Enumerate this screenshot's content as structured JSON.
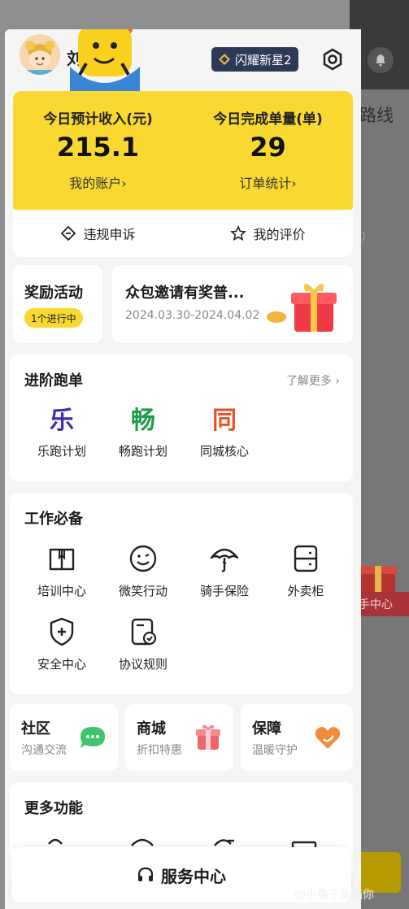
{
  "header": {
    "user_name": "刘",
    "badge_label": "闪耀新星2"
  },
  "income": {
    "today_income_label": "今日预计收入(元)",
    "today_income_value": "215.1",
    "account_link": "我的账户›",
    "today_orders_label": "今日完成单量(单)",
    "today_orders_value": "29",
    "order_stats_link": "订单统计›"
  },
  "actions": {
    "appeal_label": "违规申诉",
    "rating_label": "我的评价"
  },
  "reward": {
    "title": "奖励活动",
    "pill": "1个进行中"
  },
  "crowd": {
    "title": "众包邀请有奖普...",
    "date": "2024.03.30-2024.04.02"
  },
  "advanced": {
    "title": "进阶跑单",
    "learn_more": "了解更多 ›",
    "plans": [
      {
        "glyph": "乐",
        "label": "乐跑计划",
        "color": "#3d2fb0"
      },
      {
        "glyph": "畅",
        "label": "畅跑计划",
        "color": "#1f9b4a"
      },
      {
        "glyph": "同",
        "label": "同城核心",
        "color": "#e2542a"
      }
    ]
  },
  "work": {
    "title": "工作必备",
    "tools": [
      {
        "label": "培训中心",
        "icon": "book-icon"
      },
      {
        "label": "微笑行动",
        "icon": "smile-icon"
      },
      {
        "label": "骑手保险",
        "icon": "umbrella-icon"
      },
      {
        "label": "外卖柜",
        "icon": "locker-icon"
      },
      {
        "label": "安全中心",
        "icon": "shield-icon"
      },
      {
        "label": "协议规则",
        "icon": "agreement-icon"
      }
    ]
  },
  "mini": [
    {
      "title": "社区",
      "sub": "沟通交流",
      "icon": "chat-icon"
    },
    {
      "title": "商城",
      "sub": "折扣特惠",
      "icon": "gift-box-icon"
    },
    {
      "title": "保障",
      "sub": "温暖守护",
      "icon": "heart-icon"
    }
  ],
  "more": {
    "title": "更多功能"
  },
  "service": {
    "label": "服务中心"
  },
  "background": {
    "route_text": "路线",
    "pill_text": "手中心"
  },
  "watermark": "@小兔子偷瞄你",
  "colors": {
    "accent_yellow": "#f9d832",
    "badge_navy": "#2d3a57"
  }
}
